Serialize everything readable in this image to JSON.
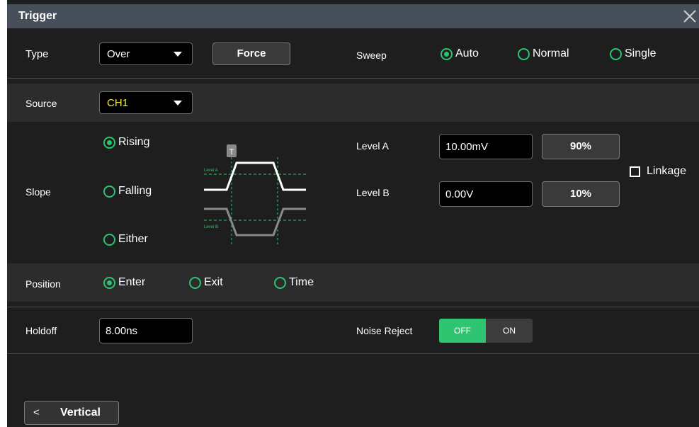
{
  "dialog": {
    "title": "Trigger"
  },
  "type": {
    "label": "Type",
    "value": "Over",
    "force_label": "Force"
  },
  "sweep": {
    "label": "Sweep",
    "options": [
      "Auto",
      "Normal",
      "Single"
    ],
    "selected": "Auto"
  },
  "source": {
    "label": "Source",
    "value": "CH1",
    "value_color": "#f1e83a"
  },
  "slope": {
    "label": "Slope",
    "options": [
      "Rising",
      "Falling",
      "Either"
    ],
    "selected": "Rising",
    "diagram": {
      "trigger_marker": "T",
      "level_a_label": "Level A",
      "level_b_label": "Level B"
    }
  },
  "levels": {
    "level_a": {
      "label": "Level A",
      "value": "10.00mV",
      "preset": "90%"
    },
    "level_b": {
      "label": "Level B",
      "value": "0.00V",
      "preset": "10%"
    },
    "linkage": {
      "label": "Linkage",
      "checked": false
    }
  },
  "position": {
    "label": "Position",
    "options": [
      "Enter",
      "Exit",
      "Time"
    ],
    "selected": "Enter"
  },
  "holdoff": {
    "label": "Holdoff",
    "value": "8.00ns"
  },
  "noise_reject": {
    "label": "Noise Reject",
    "off_label": "OFF",
    "on_label": "ON",
    "state": "OFF"
  },
  "navigation": {
    "back_label": "Vertical",
    "back_icon": "chevron-left-icon"
  },
  "colors": {
    "accent": "#29c46f",
    "titlebar": "#47505a",
    "band": "#2c2c2c",
    "background": "#1e1e1e"
  }
}
